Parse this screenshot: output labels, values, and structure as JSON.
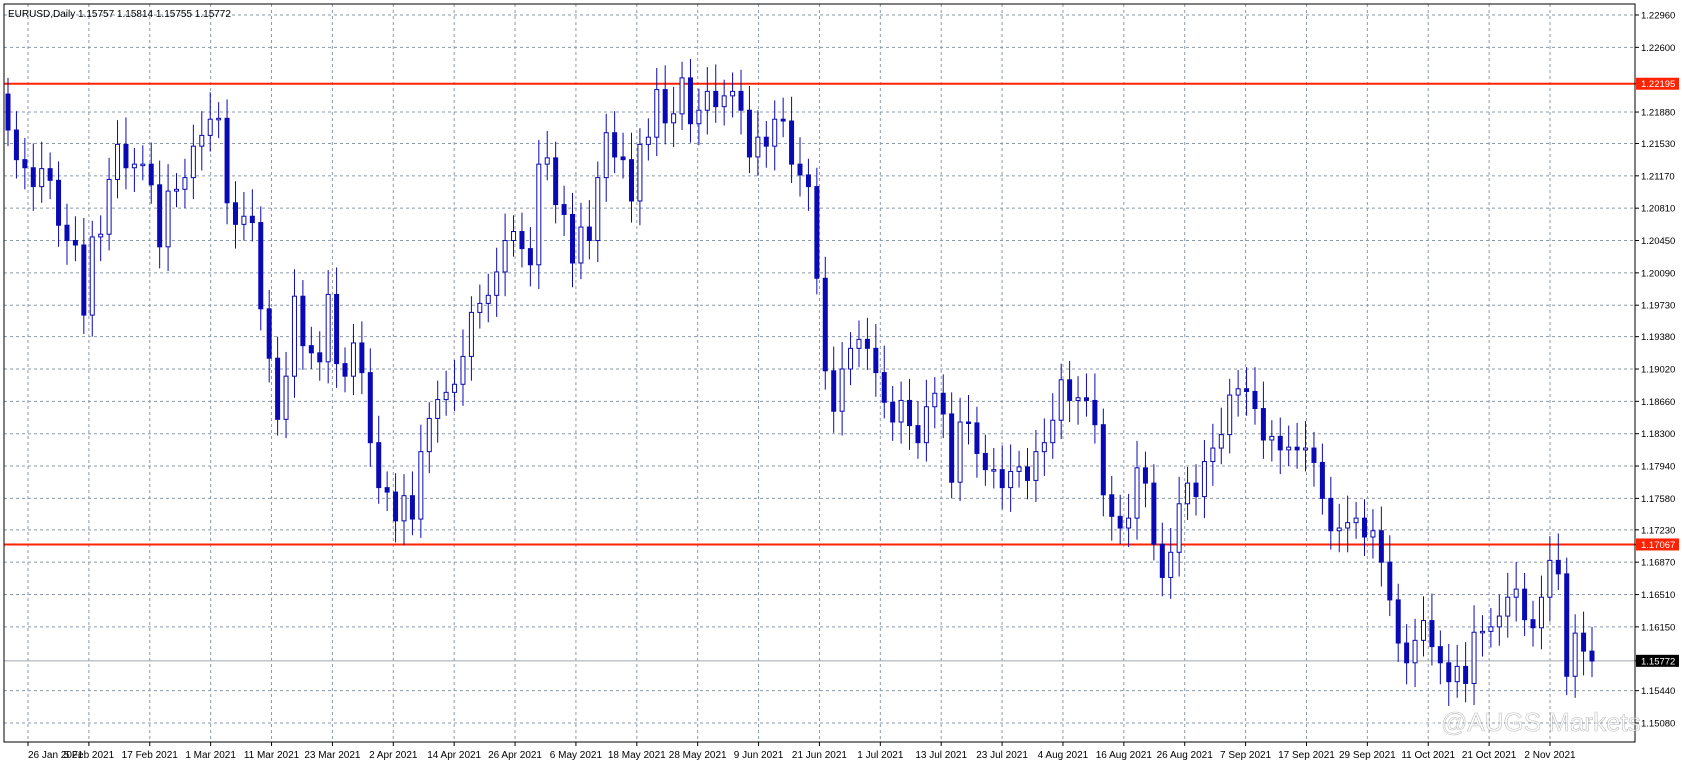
{
  "header": {
    "title": "EURUSD,Daily  1.15757 1.15814 1.15755 1.15772"
  },
  "watermark": {
    "text": "@AUGS Markets",
    "icon": "weibo-icon"
  },
  "colors": {
    "candle": "#0a0ab4",
    "level_line": "#ff2200",
    "level_label_bg": "#ff2200",
    "current_label_bg": "#000000",
    "grid": "#8c9aa8",
    "axis": "#000000"
  },
  "chart_data": {
    "type": "candlestick",
    "symbol": "EURUSD",
    "timeframe": "Daily",
    "title": "EURUSD,Daily  1.15757 1.15814 1.15755 1.15772",
    "ylim": [
      1.1508,
      1.2296
    ],
    "yticks": [
      "1.22960",
      "1.22600",
      "1.22195",
      "1.21880",
      "1.21530",
      "1.21170",
      "1.20810",
      "1.20450",
      "1.20090",
      "1.19730",
      "1.19380",
      "1.19020",
      "1.18660",
      "1.18300",
      "1.17940",
      "1.17580",
      "1.17230",
      "1.17067",
      "1.16870",
      "1.16510",
      "1.16150",
      "1.15772",
      "1.15440",
      "1.15080"
    ],
    "ytick_values": [
      1.2296,
      1.226,
      1.2188,
      1.2153,
      1.2117,
      1.2081,
      1.2045,
      1.2009,
      1.1973,
      1.1938,
      1.1902,
      1.1866,
      1.183,
      1.1794,
      1.1758,
      1.1723,
      1.1687,
      1.1651,
      1.1615,
      1.1544,
      1.1508
    ],
    "xticks": [
      "26 Jan 2021",
      "5 Feb 2021",
      "17 Feb 2021",
      "1 Mar 2021",
      "11 Mar 2021",
      "23 Mar 2021",
      "2 Apr 2021",
      "14 Apr 2021",
      "26 Apr 2021",
      "6 May 2021",
      "18 May 2021",
      "28 May 2021",
      "9 Jun 2021",
      "21 Jun 2021",
      "1 Jul 2021",
      "13 Jul 2021",
      "23 Jul 2021",
      "4 Aug 2021",
      "16 Aug 2021",
      "26 Aug 2021",
      "7 Sep 2021",
      "17 Sep 2021",
      "29 Sep 2021",
      "11 Oct 2021",
      "21 Oct 2021",
      "2 Nov 2021"
    ],
    "levels": [
      {
        "value": 1.22195,
        "label": "1.22195",
        "style": "horizontal line"
      },
      {
        "value": 1.17067,
        "label": "1.17067",
        "style": "horizontal line"
      }
    ],
    "current_price": {
      "value": 1.15772,
      "label": "1.15772"
    },
    "closes": [
      1.2168,
      1.2135,
      1.2126,
      1.2105,
      1.2125,
      1.2112,
      1.2062,
      1.2045,
      1.204,
      1.1962,
      1.2049,
      1.2052,
      1.2113,
      1.2152,
      1.2126,
      1.213,
      1.213,
      1.2107,
      1.2038,
      1.21,
      1.2102,
      1.2115,
      1.215,
      1.2162,
      1.218,
      1.2181,
      1.2087,
      1.2063,
      1.2072,
      1.2065,
      1.1969,
      1.1914,
      1.1846,
      1.1894,
      1.1983,
      1.1928,
      1.192,
      1.191,
      1.1985,
      1.1908,
      1.1894,
      1.1931,
      1.1898,
      1.182,
      1.177,
      1.1765,
      1.1733,
      1.1761,
      1.1735,
      1.181,
      1.1847,
      1.1868,
      1.1876,
      1.1885,
      1.1916,
      1.1965,
      1.1975,
      1.1984,
      1.201,
      1.2045,
      1.2055,
      1.2036,
      1.2018,
      1.213,
      1.2137,
      1.2085,
      1.2074,
      1.202,
      1.206,
      1.2045,
      1.2115,
      1.2165,
      1.2138,
      1.2135,
      1.2089,
      1.2152,
      1.216,
      1.2213,
      1.2176,
      1.2186,
      1.2226,
      1.2175,
      1.219,
      1.2211,
      1.2194,
      1.2206,
      1.2211,
      1.219,
      1.2138,
      1.216,
      1.215,
      1.218,
      1.2178,
      1.213,
      1.2118,
      1.2105,
      1.2003,
      1.19,
      1.1855,
      1.1902,
      1.1925,
      1.1935,
      1.1925,
      1.1898,
      1.1865,
      1.1843,
      1.1867,
      1.1839,
      1.182,
      1.186,
      1.1875,
      1.1852,
      1.1776,
      1.1843,
      1.1842,
      1.1808,
      1.179,
      1.179,
      1.177,
      1.1788,
      1.1793,
      1.1778,
      1.181,
      1.182,
      1.1845,
      1.189,
      1.1867,
      1.187,
      1.1867,
      1.184,
      1.1762,
      1.1738,
      1.1725,
      1.1736,
      1.1792,
      1.1775,
      1.1707,
      1.167,
      1.1698,
      1.1752,
      1.1775,
      1.176,
      1.1799,
      1.1814,
      1.1829,
      1.1873,
      1.188,
      1.1877,
      1.1858,
      1.1823,
      1.1827,
      1.1812,
      1.1815,
      1.1812,
      1.1814,
      1.1798,
      1.1758,
      1.1722,
      1.1725,
      1.1731,
      1.1736,
      1.1715,
      1.1722,
      1.1687,
      1.1645,
      1.1597,
      1.1575,
      1.16,
      1.1622,
      1.1593,
      1.1575,
      1.1554,
      1.1571,
      1.1552,
      1.1609,
      1.161,
      1.1615,
      1.1627,
      1.1648,
      1.1657,
      1.1623,
      1.1614,
      1.1648,
      1.1689,
      1.1674,
      1.156,
      1.1608,
      1.1588,
      1.1577
    ]
  }
}
